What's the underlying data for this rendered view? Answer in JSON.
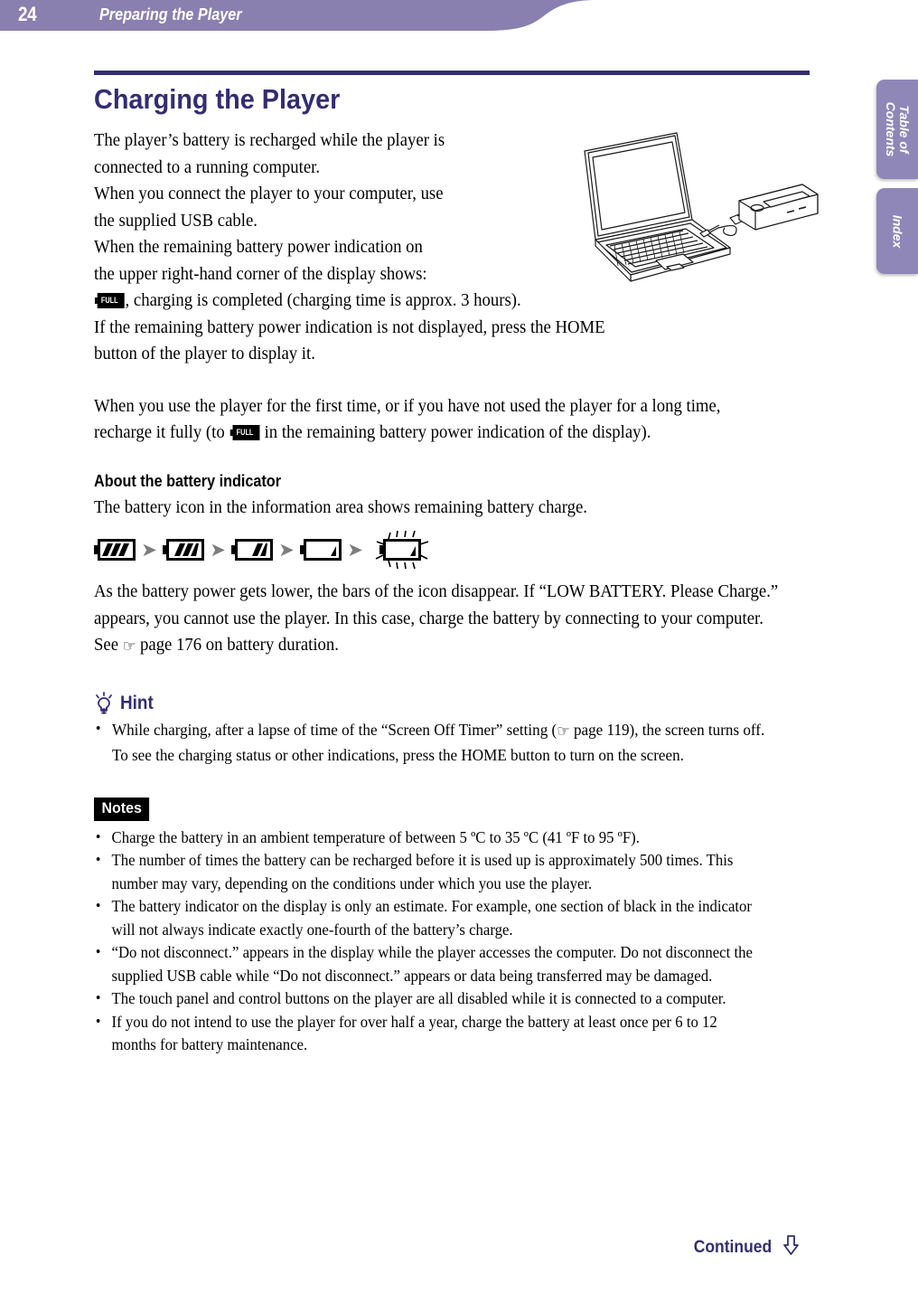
{
  "header": {
    "page_number": "24",
    "section_title": "Preparing the Player",
    "bar_color": "#8980b0"
  },
  "side_tabs": [
    {
      "label": "Table of\nContents",
      "name": "table-of-contents"
    },
    {
      "label": "Index",
      "name": "index"
    }
  ],
  "main": {
    "title": "Charging the Player",
    "title_color": "#332d72",
    "intro_lines": [
      "The player’s battery is recharged while the player is",
      "connected to a running computer.",
      "When you connect the player to your computer, use",
      "the supplied USB cable.",
      "When the remaining battery power indication on",
      "the upper right-hand corner of the display shows:"
    ],
    "intro_after_icon": ", charging is completed (charging time is approx. 3 hours).",
    "intro_tail_lines": [
      "If the remaining battery power indication is not displayed, press the HOME",
      "button of the player to display it."
    ],
    "first_time_pre": "When you use the player for the first time, or if you have not used the player for a long time, recharge it fully (to ",
    "first_time_post": " in the remaining battery power indication of the display).",
    "sub_heading": "About the battery indicator",
    "sub_heading_body": "The battery icon in the information area shows remaining battery charge.",
    "battery_icon_label": "FULL",
    "battery_sequence": {
      "steps": [
        {
          "bars": 3,
          "flashing": false
        },
        {
          "bars": 2,
          "flashing": false
        },
        {
          "bars": 1.5,
          "flashing": false
        },
        {
          "bars": 0.5,
          "flashing": false
        },
        {
          "bars": 0.5,
          "flashing": true
        }
      ],
      "arrow_glyph": "➜",
      "arrow_color": "#7d7d7d"
    },
    "low_battery_text_pre": "As the battery power gets lower, the bars of the icon disappear. If “LOW BATTERY. Please Charge.” appears, you cannot use the player. In this case, charge the battery by connecting to your computer. See ",
    "low_battery_page_ref": " page 176",
    "low_battery_text_post": " on battery duration."
  },
  "hint": {
    "heading": "Hint",
    "heading_color": "#332d72",
    "icon": "lightbulb-icon",
    "items": [
      {
        "pre": "While charging, after a lapse of time of the “Screen Off Timer” setting (",
        "page_ref": " page 119",
        "post": "), the screen turns off. To see the charging status or other indications, press the HOME button to turn on the screen."
      }
    ]
  },
  "notes": {
    "badge": "Notes",
    "badge_bg": "#000000",
    "items": [
      "Charge the battery in an ambient temperature of between 5 ºC to 35 ºC (41 ºF to 95 ºF).",
      "The number of times the battery can be recharged before it is used up is approximately 500 times. This number may vary, depending on the conditions under which you use the player.",
      "The battery indicator on the display is only an estimate. For example, one section of black in the indicator will not always indicate exactly one-fourth of the battery’s charge.",
      "“Do not disconnect.” appears in the display while the player accesses the computer. Do not disconnect the supplied USB cable while “Do not disconnect.” appears or data being transferred may be damaged.",
      "The touch panel and control buttons on the player are all disabled while it is connected to a computer.",
      "If you do not intend to use the player for over half a year, charge the battery at least once per 6 to 12 months for battery maintenance."
    ]
  },
  "footer": {
    "continued_label": "Continued",
    "arrow": "down-arrow-icon"
  },
  "illustration": {
    "name": "laptop-usb-player-illustration",
    "description": "Line drawing of an open laptop connected by USB cable to a portable media player"
  }
}
